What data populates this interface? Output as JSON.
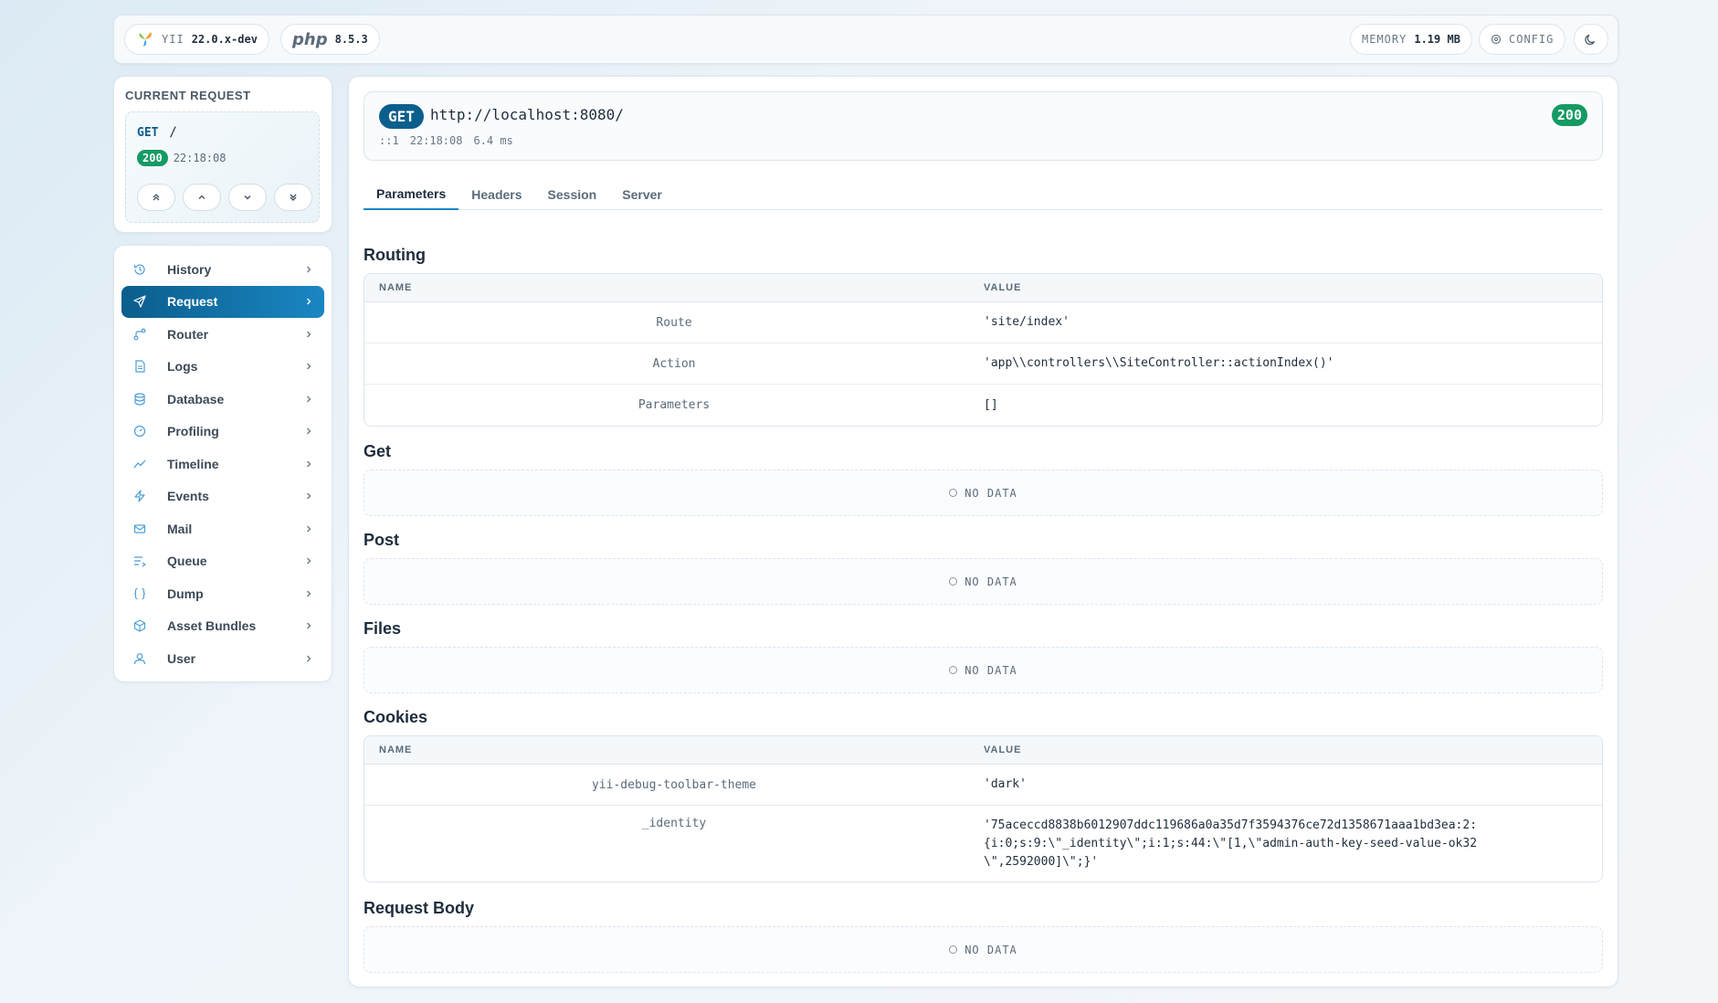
{
  "topbar": {
    "framework_label": "YII",
    "framework_version": "22.0.x-dev",
    "php_label": "php",
    "php_version": "8.5.3",
    "memory_label": "MEMORY",
    "memory_value": "1.19 MB",
    "config_label": "CONFIG"
  },
  "current_request": {
    "title": "CURRENT REQUEST",
    "method": "GET",
    "path": "/",
    "status": "200",
    "time": "22:18:08"
  },
  "sidebar": {
    "items": [
      {
        "label": "History",
        "icon": "history-icon"
      },
      {
        "label": "Request",
        "icon": "send-icon",
        "active": true
      },
      {
        "label": "Router",
        "icon": "route-icon"
      },
      {
        "label": "Logs",
        "icon": "file-text-icon"
      },
      {
        "label": "Database",
        "icon": "database-icon"
      },
      {
        "label": "Profiling",
        "icon": "gauge-icon"
      },
      {
        "label": "Timeline",
        "icon": "trend-icon"
      },
      {
        "label": "Events",
        "icon": "zap-icon"
      },
      {
        "label": "Mail",
        "icon": "mail-icon"
      },
      {
        "label": "Queue",
        "icon": "queue-icon"
      },
      {
        "label": "Dump",
        "icon": "braces-icon"
      },
      {
        "label": "Asset Bundles",
        "icon": "package-icon"
      },
      {
        "label": "User",
        "icon": "user-icon"
      }
    ]
  },
  "request": {
    "method": "GET",
    "url": "http://localhost:8080/",
    "ip": "::1",
    "time": "22:18:08",
    "duration": "6.4 ms",
    "status": "200"
  },
  "tabs": [
    "Parameters",
    "Headers",
    "Session",
    "Server"
  ],
  "table_headers": {
    "name": "NAME",
    "value": "VALUE"
  },
  "no_data": "NO DATA",
  "sections": {
    "routing": {
      "title": "Routing",
      "rows": [
        {
          "name": "Route",
          "value": "'site/index'"
        },
        {
          "name": "Action",
          "value": "'app\\\\controllers\\\\SiteController::actionIndex()'"
        },
        {
          "name": "Parameters",
          "value": "[]"
        }
      ]
    },
    "get": {
      "title": "Get"
    },
    "post": {
      "title": "Post"
    },
    "files": {
      "title": "Files"
    },
    "cookies": {
      "title": "Cookies",
      "rows": [
        {
          "name": "yii-debug-toolbar-theme",
          "value": "'dark'"
        },
        {
          "name": "_identity",
          "value": "'75aceccd8838b6012907ddc119686a0a35d7f3594376ce72d1358671aaa1bd3ea:2:{i:0;s:9:\\\"_identity\\\";i:1;s:44:\\\"[1,\\\"admin-auth-key-seed-value-ok32\\\",2592000]\\\";}'"
        }
      ]
    },
    "request_body": {
      "title": "Request Body"
    }
  },
  "colors": {
    "accent": "#0b5e8c",
    "success": "#159a63",
    "icon": "#4d9ed4"
  }
}
